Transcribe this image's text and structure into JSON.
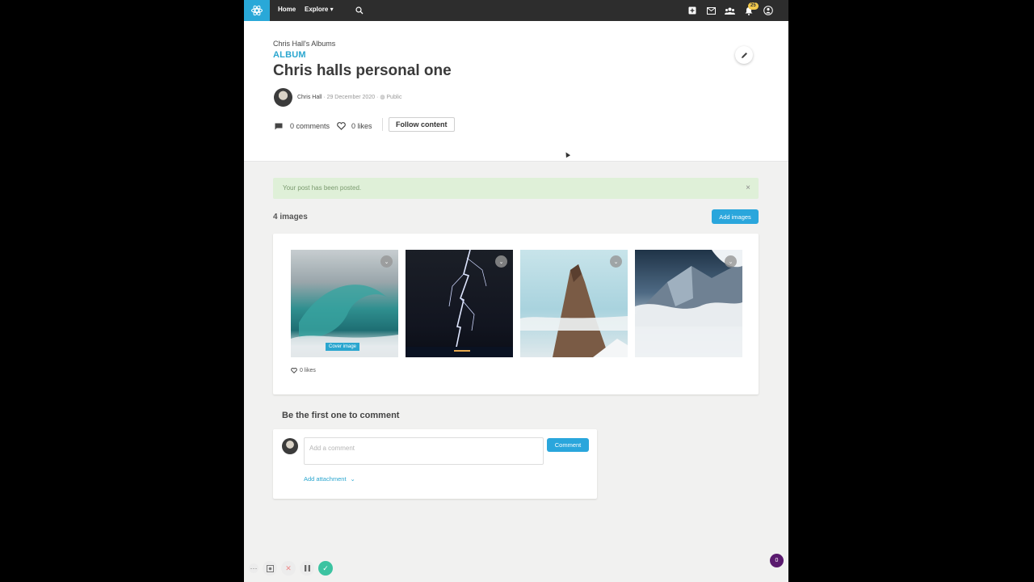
{
  "nav": {
    "home": "Home",
    "explore": "Explore",
    "notification_count": "25",
    "icons": [
      "logo-icon",
      "search-icon",
      "add-icon",
      "mail-icon",
      "groups-icon",
      "bell-icon",
      "user-icon"
    ]
  },
  "header": {
    "breadcrumb": "Chris Hall's Albums",
    "type_label": "ALBUM",
    "title": "Chris halls personal one",
    "author": "Chris Hall",
    "date": " · 29 December 2020 · ",
    "visibility": "Public",
    "comments_label": "0 comments",
    "likes_label": "0 likes",
    "follow_label": "Follow content"
  },
  "alert": {
    "message": "Your post has been posted.",
    "close": "×"
  },
  "gallery": {
    "count_label": "4 images",
    "add_label": "Add images",
    "cover_label": "Cover image",
    "likes_label": "0 likes",
    "images": [
      "wave",
      "lightning",
      "rock-spire",
      "misty-mountain"
    ]
  },
  "comments": {
    "heading": "Be the first one to comment",
    "placeholder": "Add a comment",
    "submit_label": "Comment",
    "attachment_label": "Add attachment"
  },
  "chat": {
    "count": "0"
  },
  "colors": {
    "accent": "#2aa6dc",
    "nav_bg": "#2d2d2d",
    "alert_bg": "#dff0d8",
    "chat_bg": "#5a1a6e"
  }
}
